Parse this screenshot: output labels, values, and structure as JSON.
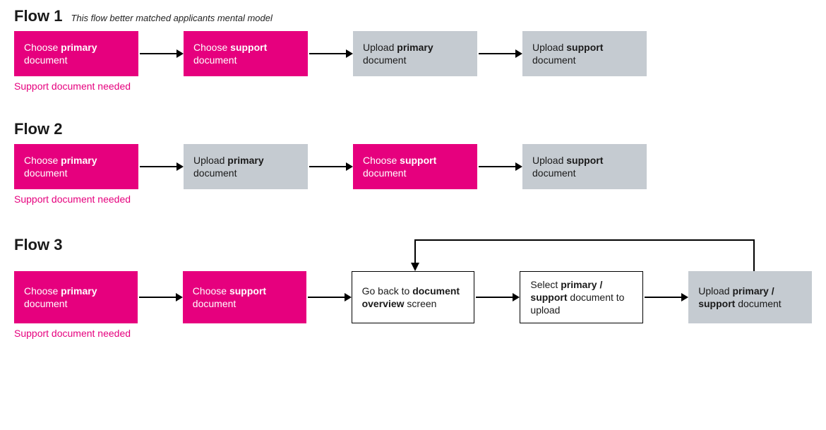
{
  "flows": [
    {
      "title": "Flow 1",
      "subtitle": "This flow better matched applicants mental model",
      "caption": "Support document needed",
      "steps": [
        {
          "kind": "pink",
          "pre": "Choose ",
          "bold": "primary",
          "post": " document"
        },
        {
          "kind": "pink",
          "pre": "Choose ",
          "bold": "support",
          "post": " document"
        },
        {
          "kind": "grey",
          "pre": "Upload ",
          "bold": "primary",
          "post": " document"
        },
        {
          "kind": "grey",
          "pre": "Upload ",
          "bold": "support",
          "post": " document"
        }
      ]
    },
    {
      "title": "Flow 2",
      "subtitle": "",
      "caption": "Support document needed",
      "steps": [
        {
          "kind": "pink",
          "pre": "Choose ",
          "bold": "primary",
          "post": " document"
        },
        {
          "kind": "grey",
          "pre": "Upload ",
          "bold": "primary",
          "post": " document"
        },
        {
          "kind": "pink",
          "pre": "Choose ",
          "bold": "support",
          "post": " document"
        },
        {
          "kind": "grey",
          "pre": "Upload ",
          "bold": "support",
          "post": " document"
        }
      ]
    },
    {
      "title": "Flow 3",
      "subtitle": "",
      "caption": "Support document needed",
      "steps": [
        {
          "kind": "pink",
          "pre": "Choose ",
          "bold": "primary",
          "post": " document"
        },
        {
          "kind": "pink",
          "pre": "Choose ",
          "bold": "support",
          "post": " document"
        },
        {
          "kind": "outline",
          "pre": "Go back to ",
          "bold": "document overview",
          "post": " screen"
        },
        {
          "kind": "outline",
          "pre": "Select ",
          "bold": "primary / support",
          "post": " document to upload"
        },
        {
          "kind": "grey",
          "pre": "Upload ",
          "bold": "primary / support",
          "post": " document"
        }
      ]
    }
  ]
}
